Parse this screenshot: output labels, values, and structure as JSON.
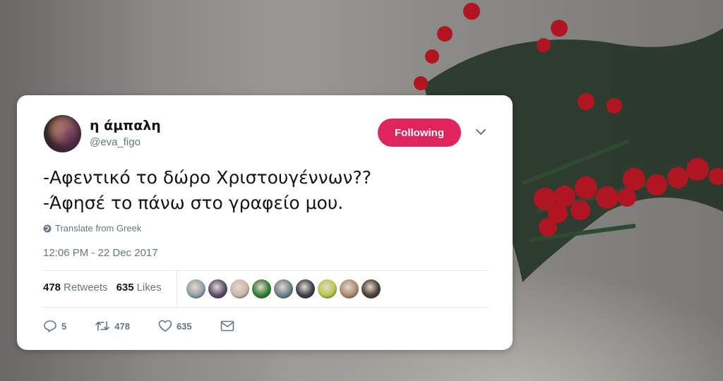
{
  "user": {
    "display_name": "η άμπαλη",
    "handle": "@eva_figo"
  },
  "follow_button": {
    "label": "Following",
    "color": "#e0245e"
  },
  "tweet": {
    "lines": [
      "-Αφεντικό το δώρο Χριστουγέννων??",
      "-Άφησέ το πάνω στο γραφείο μου."
    ],
    "translate_label": "Translate from Greek",
    "timestamp": "12:06 PM - 22 Dec 2017"
  },
  "stats": {
    "retweets_count": "478",
    "retweets_label": "Retweets",
    "likes_count": "635",
    "likes_label": "Likes"
  },
  "likers": [
    {
      "icon": "avatar-1",
      "color": "#8fa1a8"
    },
    {
      "icon": "avatar-2",
      "color": "#5a4a6e"
    },
    {
      "icon": "avatar-3",
      "color": "#c9b7a8"
    },
    {
      "icon": "avatar-4",
      "color": "#2e7d32"
    },
    {
      "icon": "avatar-5",
      "color": "#6b7f8c"
    },
    {
      "icon": "avatar-6",
      "color": "#3b3f4a"
    },
    {
      "icon": "avatar-7",
      "color": "#b5c94a"
    },
    {
      "icon": "avatar-8",
      "color": "#a88c72"
    },
    {
      "icon": "avatar-9",
      "color": "#4a3e36"
    }
  ],
  "actions": {
    "reply_count": "5",
    "retweet_count": "478",
    "like_count": "635",
    "reply_icon": "reply-icon",
    "retweet_icon": "retweet-icon",
    "like_icon": "heart-icon",
    "message_icon": "envelope-icon"
  },
  "colors": {
    "text_dark": "#14171a",
    "text_muted": "#657786",
    "accent": "#e0245e"
  }
}
